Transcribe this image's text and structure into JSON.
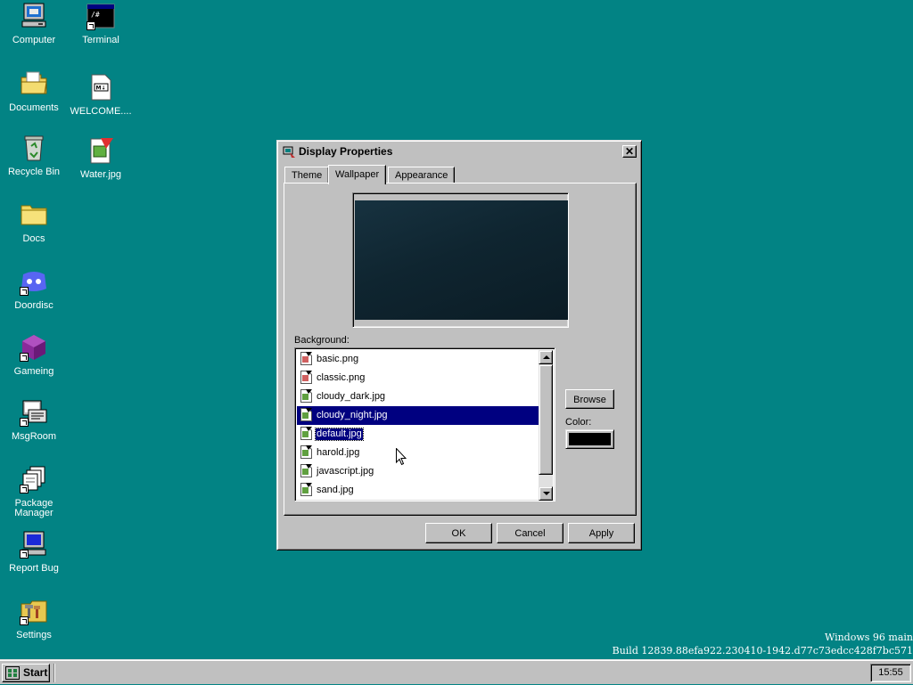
{
  "desktop": {
    "icons": [
      {
        "label": "Computer",
        "icon": "computer-icon"
      },
      {
        "label": "Terminal",
        "icon": "terminal-icon"
      },
      {
        "label": "Documents",
        "icon": "documents-folder-icon"
      },
      {
        "label": "WELCOME....",
        "icon": "markdown-file-icon"
      },
      {
        "label": "Recycle Bin",
        "icon": "recycle-bin-icon"
      },
      {
        "label": "Water.jpg",
        "icon": "image-file-icon"
      },
      {
        "label": "Docs",
        "icon": "folder-icon"
      },
      {
        "label": "Doordisc",
        "icon": "doordisc-icon"
      },
      {
        "label": "Gameing",
        "icon": "game-cube-icon"
      },
      {
        "label": "MsgRoom",
        "icon": "msgroom-icon"
      },
      {
        "label": "Package Manager",
        "icon": "package-manager-icon"
      },
      {
        "label": "Report Bug",
        "icon": "report-bug-icon"
      },
      {
        "label": "Settings",
        "icon": "settings-icon"
      }
    ],
    "build_info": {
      "line1": "Windows 96 main",
      "line2": "Build 12839.88efa922.230410-1942.d77c73edcc428f7bc571"
    }
  },
  "dialog": {
    "title": "Display Properties",
    "close_label": "✕",
    "tabs": [
      {
        "label": "Theme",
        "active": false
      },
      {
        "label": "Wallpaper",
        "active": true
      },
      {
        "label": "Appearance",
        "active": false
      }
    ],
    "background_label": "Background:",
    "files": [
      {
        "name": "basic.png",
        "state": "normal"
      },
      {
        "name": "classic.png",
        "state": "normal"
      },
      {
        "name": "cloudy_dark.jpg",
        "state": "normal"
      },
      {
        "name": "cloudy_night.jpg",
        "state": "selected"
      },
      {
        "name": "default.jpg",
        "state": "focused"
      },
      {
        "name": "harold.jpg",
        "state": "normal"
      },
      {
        "name": "javascript.jpg",
        "state": "normal"
      },
      {
        "name": "sand.jpg",
        "state": "normal"
      }
    ],
    "browse_label": "Browse",
    "color_label": "Color:",
    "color_value": "#000000",
    "ok_label": "OK",
    "cancel_label": "Cancel",
    "apply_label": "Apply"
  },
  "taskbar": {
    "start_label": "Start",
    "clock": "15:55"
  },
  "colors": {
    "desktop": "#028384",
    "selection": "#000080",
    "face": "#c0c0c0"
  }
}
